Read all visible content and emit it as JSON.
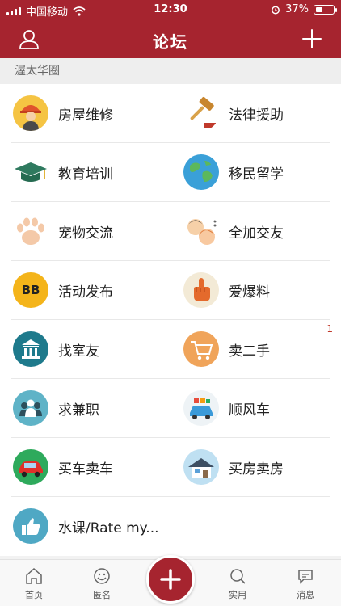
{
  "status_bar": {
    "carrier": "中国移动",
    "time": "12:30",
    "battery": "37%"
  },
  "nav": {
    "title": "论坛"
  },
  "section": {
    "label": "渥太华圈"
  },
  "forum": {
    "items": [
      {
        "label": "房屋维修",
        "icon": "repair-worker-icon"
      },
      {
        "label": "法律援助",
        "icon": "gavel-icon"
      },
      {
        "label": "教育培训",
        "icon": "graduation-cap-icon"
      },
      {
        "label": "移民留学",
        "icon": "globe-icon"
      },
      {
        "label": "宠物交流",
        "icon": "paw-icon"
      },
      {
        "label": "全加交友",
        "icon": "friends-icon"
      },
      {
        "label": "活动发布",
        "icon": "bb-icon",
        "icon_text": "BB"
      },
      {
        "label": "爱爆料",
        "icon": "pointing-hand-icon"
      },
      {
        "label": "找室友",
        "icon": "bank-building-icon"
      },
      {
        "label": "卖二手",
        "icon": "shopping-cart-icon",
        "badge": "1"
      },
      {
        "label": "求兼职",
        "icon": "people-group-icon"
      },
      {
        "label": "顺风车",
        "icon": "car-trip-icon"
      },
      {
        "label": "买车卖车",
        "icon": "red-car-icon"
      },
      {
        "label": "买房卖房",
        "icon": "house-icon"
      },
      {
        "label": "水课/Rate my...",
        "icon": "thumbs-up-icon"
      }
    ]
  },
  "tabs": {
    "home": "首页",
    "anonymous": "匿名",
    "practical": "实用",
    "messages": "消息"
  },
  "colors": {
    "brand": "#a6242f",
    "badge": "#c0392b"
  }
}
